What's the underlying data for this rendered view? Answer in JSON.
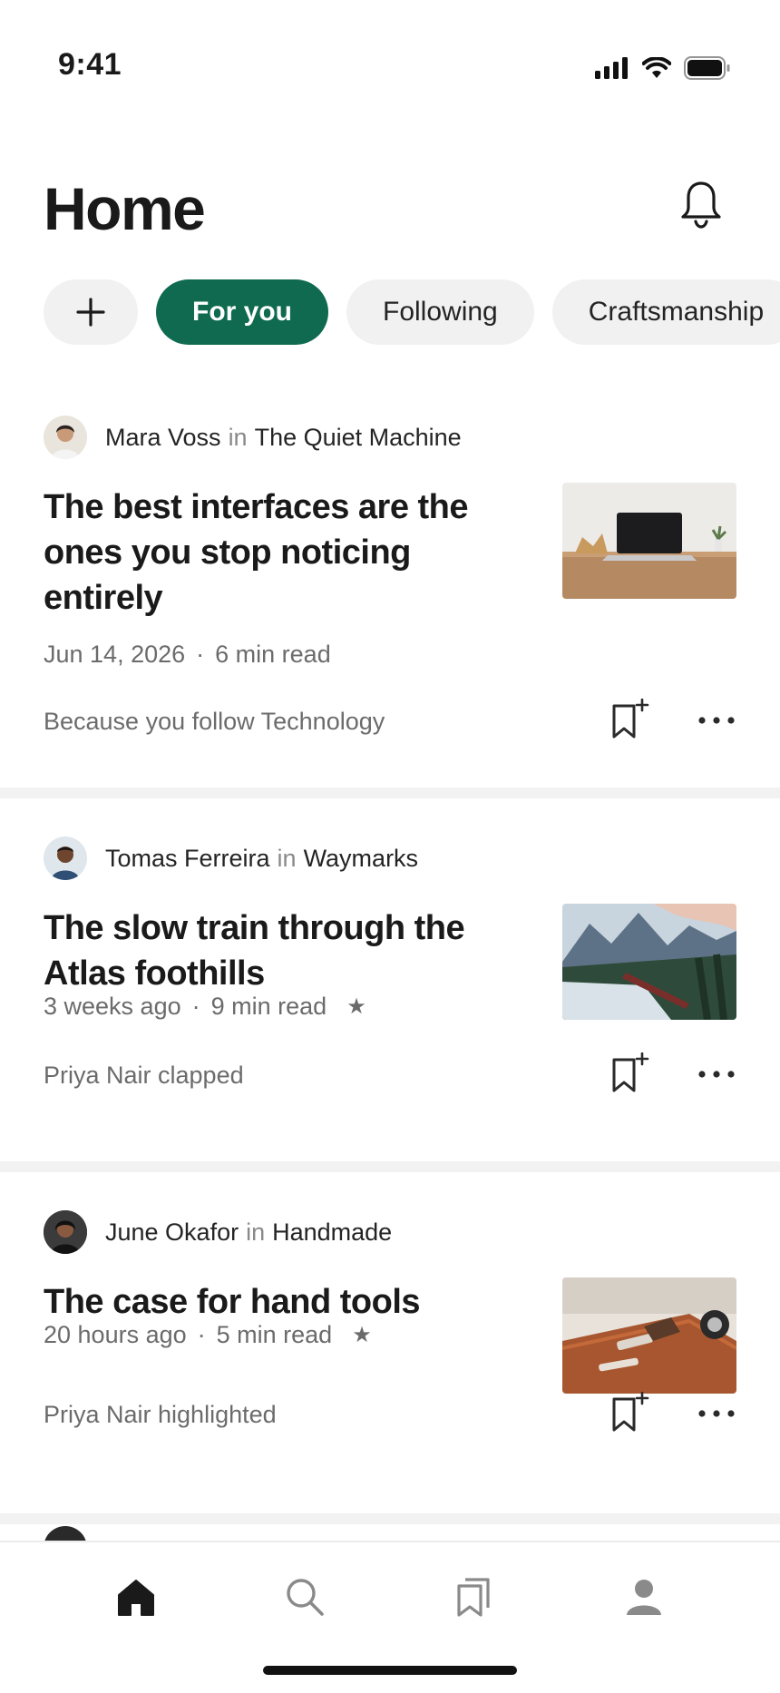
{
  "status_bar": {
    "time": "9:41"
  },
  "header": {
    "title": "Home"
  },
  "chips": [
    {
      "label": "For you",
      "active": true
    },
    {
      "label": "Following",
      "active": false
    },
    {
      "label": "Craftsmanship",
      "active": false
    }
  ],
  "articles": [
    {
      "author": "Mara Voss",
      "in_label": "in",
      "publication": "The Quiet Machine",
      "title": "The best interfaces are the ones you stop noticing entirely",
      "date": "Jun 14, 2026",
      "read_time": "6 min read",
      "starred": false,
      "reason": "Because you follow Technology",
      "thumbnail_icon": "laptop-on-desk-image"
    },
    {
      "author": "Tomas Ferreira",
      "in_label": "in",
      "publication": "Waymarks",
      "title": "The slow train through the Atlas foothills",
      "date": "3 weeks ago",
      "read_time": "9 min read",
      "starred": true,
      "reason": "Priya Nair clapped",
      "thumbnail_icon": "mountain-train-image"
    },
    {
      "author": "June Okafor",
      "in_label": "in",
      "publication": "Handmade",
      "title": "The case for hand tools",
      "date": "20 hours ago",
      "read_time": "5 min read",
      "starred": true,
      "reason": "Priya Nair highlighted",
      "thumbnail_icon": "workbench-tools-image"
    }
  ],
  "meta_separator": "·",
  "star_glyph": "★",
  "tabbar": [
    "home",
    "search",
    "library",
    "profile"
  ],
  "colors": {
    "accent": "#0f6a4f",
    "chip_bg": "#f1f1f1",
    "muted_text": "#6b6b6b"
  }
}
